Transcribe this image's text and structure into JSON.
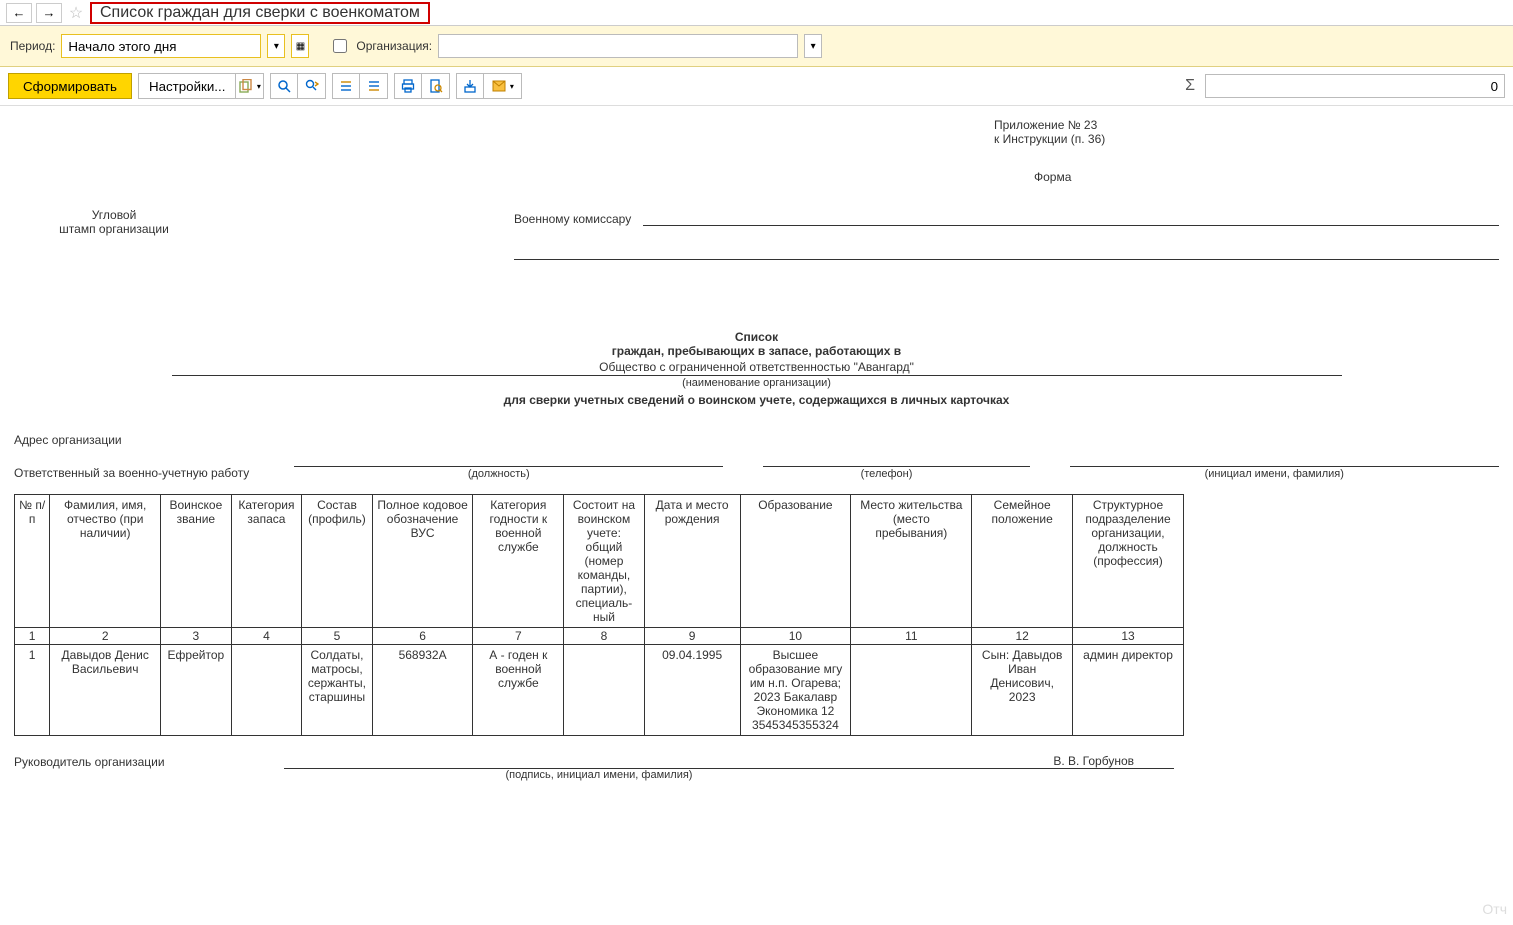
{
  "title": "Список граждан для сверки с военкоматом",
  "filters": {
    "period_label": "Период:",
    "period_value": "Начало этого дня",
    "org_label": "Организация:",
    "org_value": ""
  },
  "toolbar": {
    "generate": "Сформировать",
    "settings": "Настройки..."
  },
  "sum_value": "0",
  "appendix": {
    "line1": "Приложение № 23",
    "line2": "к Инструкции (п. 36)",
    "forma": "Форма"
  },
  "stamp": {
    "line1": "Угловой",
    "line2": "штамп организации"
  },
  "commissar_label": "Военному комиссару",
  "heading": {
    "l1": "Список",
    "l2": "граждан, пребывающих в запасе, работающих в",
    "org_name": "Общество с ограниченной ответственностью \"Авангард\"",
    "org_caption": "(наименование организации)",
    "l3": "для сверки учетных сведений о воинском учете, содержащихся в личных карточках"
  },
  "addr_label": "Адрес организации",
  "resp_label": "Ответственный за военно-учетную работу",
  "sig_captions": {
    "position": "(должность)",
    "phone": "(телефон)",
    "name": "(инициал имени, фамилия)"
  },
  "columns": [
    "№ п/п",
    "Фамилия, имя, отчество (при наличии)",
    "Воинское звание",
    "Категория запаса",
    "Состав (профиль)",
    "Полное кодовое обозначение ВУС",
    "Категория годности к военной службе",
    "Состоит на воинском учете: общий (номер команды, партии), специаль-ный",
    "Дата и место рождения",
    "Образование",
    "Место жительства (место пребывания)",
    "Семейное положение",
    "Структурное подразделение организации, должность (профессия)"
  ],
  "numrow": [
    "1",
    "2",
    "3",
    "4",
    "5",
    "6",
    "7",
    "8",
    "9",
    "10",
    "11",
    "12",
    "13"
  ],
  "rows": [
    {
      "n": "1",
      "fio": "Давыдов Денис Васильевич",
      "rank": "Ефрейтор",
      "reserve_cat": "",
      "profile": "Солдаты, матросы, сержанты, старшины",
      "vus": "568932А",
      "fitness": "А - годен к военной службе",
      "registered": "",
      "birth": "09.04.1995",
      "education": "Высшее образование мгу им н.п. Огарева; 2023 Бакалавр Экономика 12 3545345355324",
      "residence": "",
      "family": "Сын: Давыдов Иван Денисович, 2023",
      "position": "админ директор"
    }
  ],
  "footer": {
    "head_label": "Руководитель организации",
    "head_name": "В. В. Горбунов",
    "caption": "(подпись, инициал имени, фамилия)"
  },
  "ghost": "Отч"
}
